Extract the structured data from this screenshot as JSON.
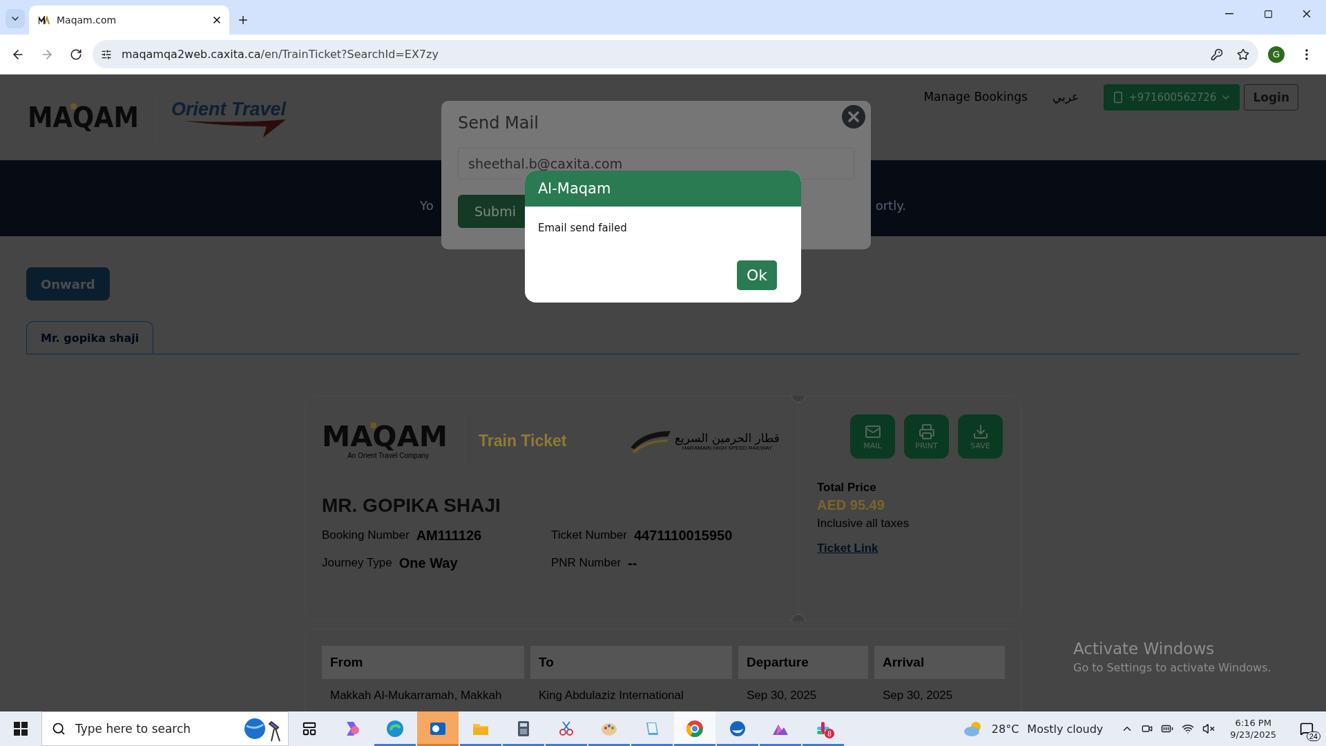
{
  "browser": {
    "tabs": [
      {
        "title": "Maqam.com",
        "selected": true
      }
    ],
    "url_host": "maqamqa2web.caxita.ca",
    "url_path": "/en/TrainTicket?SearchId=EX7zy",
    "profile_initial": "G"
  },
  "header": {
    "logo_text": "MAQAM",
    "partner_logo_text": "Orient Travel",
    "nav": [
      {
        "label": "Manage Bookings"
      },
      {
        "label": "عربي"
      }
    ],
    "phone": "+971600562726",
    "login": "Login"
  },
  "banner": {
    "text_left": "Yo",
    "text_right": "ortly."
  },
  "trip_button": "Onward",
  "passenger_tabs": [
    {
      "label": "Mr. gopika shaji",
      "selected": true
    }
  ],
  "ticket": {
    "logo_text": "MAQAM",
    "logo_tagline": "An Orient Travel Company",
    "title": "Train Ticket",
    "operator_arabic": "قطار الحرمين السريع",
    "operator_english": "HARAMAIN HIGH SPEED RAILWAY",
    "actions": [
      {
        "kind": "mail",
        "label": "MAIL"
      },
      {
        "kind": "print",
        "label": "PRINT"
      },
      {
        "kind": "save",
        "label": "SAVE"
      }
    ],
    "passenger_name": "MR. GOPIKA SHAJI",
    "fields": [
      {
        "label": "Booking Number",
        "value": "AM111126"
      },
      {
        "label": "Ticket Number",
        "value": "4471110015950"
      },
      {
        "label": "Journey Type",
        "value": "One Way"
      },
      {
        "label": "PNR Number",
        "value": "--"
      }
    ],
    "price": {
      "label": "Total Price",
      "amount": "AED 95.49",
      "note": "Inclusive all taxes",
      "link": "Ticket Link"
    }
  },
  "segments": {
    "columns": [
      "From",
      "To",
      "Departure",
      "Arrival"
    ],
    "rows": [
      [
        "Makkah Al-Mukarramah, Makkah",
        "King Abdulaziz International",
        "Sep 30, 2025",
        "Sep 30, 2025"
      ]
    ]
  },
  "send_mail_modal": {
    "title": "Send Mail",
    "email": "sheethal.b@caxita.com",
    "submit": "Submi"
  },
  "alert": {
    "title": "Al-Maqam",
    "message": "Email send failed",
    "button": "Ok"
  },
  "activation": {
    "title": "Activate Windows",
    "message": "Go to Settings to activate Windows."
  },
  "taskbar": {
    "search_placeholder": "Type here to search",
    "apps": [
      {
        "running": false,
        "selected": false,
        "flashing": false
      },
      {
        "running": true,
        "selected": false,
        "flashing": false
      },
      {
        "running": true,
        "selected": false,
        "flashing": true
      },
      {
        "running": true,
        "selected": false,
        "flashing": false
      },
      {
        "running": true,
        "selected": false,
        "flashing": false
      },
      {
        "running": true,
        "selected": false,
        "flashing": false
      },
      {
        "running": true,
        "selected": false,
        "flashing": false
      },
      {
        "running": true,
        "selected": false,
        "flashing": false
      },
      {
        "running": true,
        "selected": true,
        "flashing": false
      },
      {
        "running": true,
        "selected": false,
        "flashing": false
      },
      {
        "running": true,
        "selected": false,
        "flashing": false
      },
      {
        "running": true,
        "selected": false,
        "flashing": false,
        "badge": "8"
      }
    ],
    "temperature": "28°C",
    "weather": "Mostly cloudy",
    "time": "6:16 PM",
    "date": "9/23/2025",
    "notifications": "24"
  }
}
